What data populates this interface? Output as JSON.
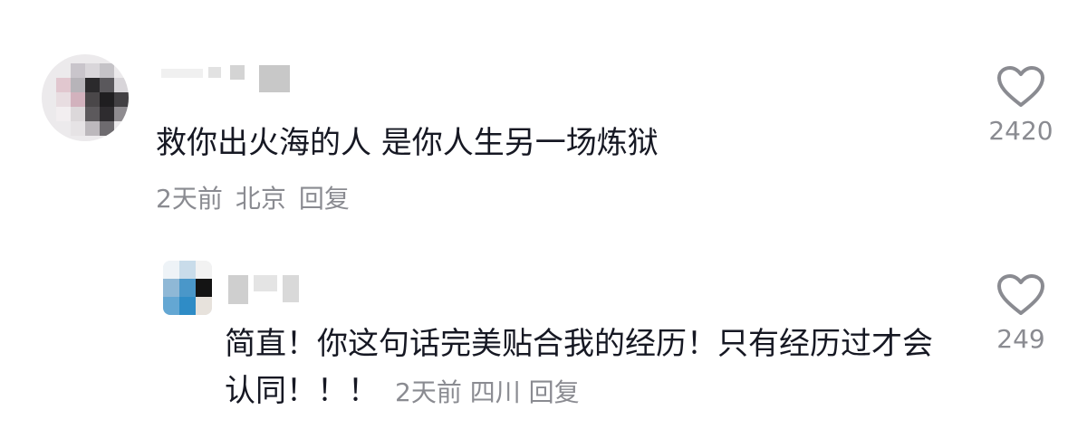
{
  "comment": {
    "text": "救你出火海的人 是你人生另一场炼狱",
    "time": "2天前",
    "location": "北京",
    "reply_label": "回复",
    "likes": "2420"
  },
  "reply": {
    "text": "简直！你这句话完美贴合我的经历！只有经历过才会认同！！！",
    "time": "2天前",
    "location": "四川",
    "reply_label": "回复",
    "likes": "249"
  },
  "icons": {
    "like": "heart-outline-icon"
  },
  "colors": {
    "text": "#161823",
    "meta": "#8a8b91",
    "icon": "#8a8b91"
  }
}
